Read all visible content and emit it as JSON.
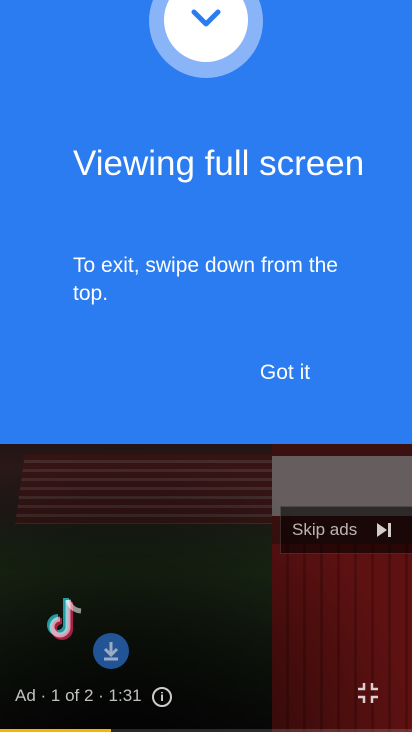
{
  "dialog": {
    "title": "Viewing full screen",
    "body": "To exit, swipe down from the top.",
    "got_it_label": "Got it",
    "icon": "chevron-down-icon",
    "accent": "#2a7cf0"
  },
  "video": {
    "skip_label": "Skip ads",
    "skip_icon": "skip-next-icon",
    "ad_info": "Ad · 1 of 2 · 1:31",
    "info_icon": "info-icon",
    "exit_fullscreen_icon": "exit-fullscreen-icon",
    "app_logo": "tiktok-logo",
    "download_icon": "download-icon",
    "progress_fraction": 0.27,
    "progress_color": "#f5b400"
  }
}
